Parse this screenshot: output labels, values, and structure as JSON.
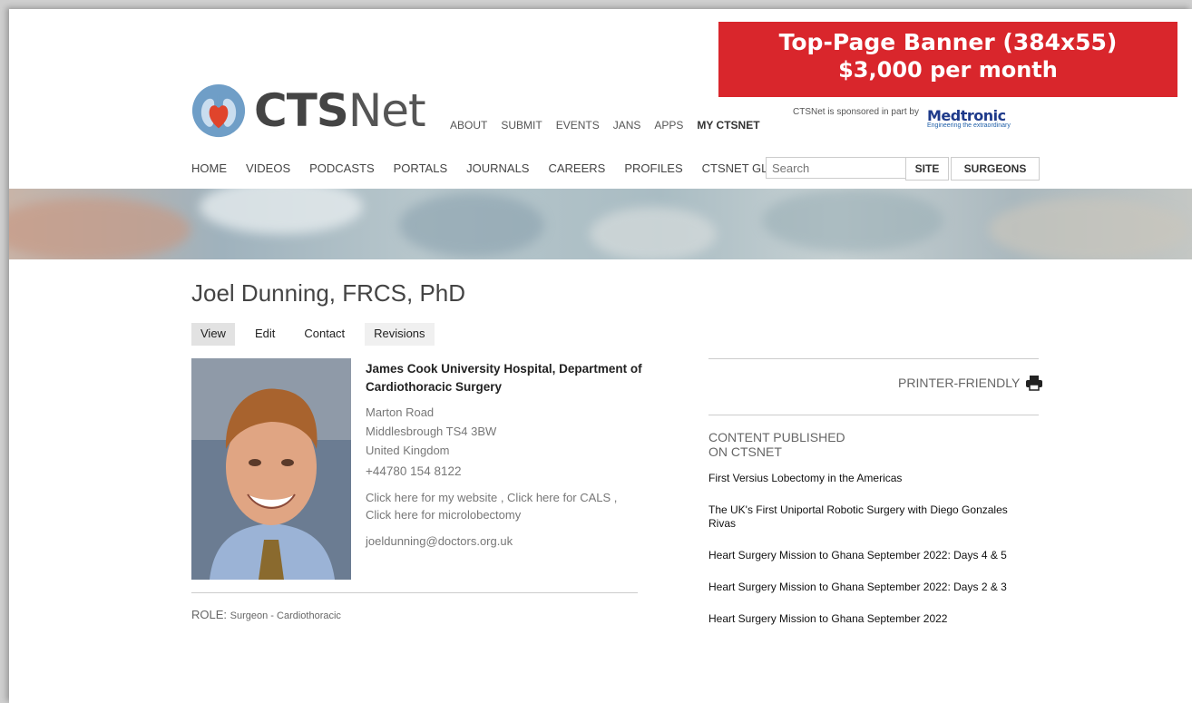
{
  "ad_banner": {
    "line1": "Top-Page Banner (384x55)",
    "line2": "$3,000 per month",
    "color": "#d9262c"
  },
  "logo": {
    "bold": "CTS",
    "light": "Net",
    "icon": "heart-lungs-logo"
  },
  "top_nav": [
    "ABOUT",
    "SUBMIT",
    "EVENTS",
    "JANS",
    "APPS",
    "MY CTSNET"
  ],
  "sponsor": {
    "text": "CTSNet is sponsored in part by",
    "brand": "Medtronic",
    "tagline": "Engineering the extraordinary"
  },
  "main_nav": [
    "HOME",
    "VIDEOS",
    "PODCASTS",
    "PORTALS",
    "JOURNALS",
    "CAREERS",
    "PROFILES",
    "CTSNET GLOBAL"
  ],
  "search": {
    "placeholder": "Search",
    "site_label": "SITE",
    "surgeons_label": "SURGEONS"
  },
  "profile": {
    "name": "Joel Dunning, FRCS, PhD",
    "tabs": [
      "View",
      "Edit",
      "Contact",
      "Revisions"
    ],
    "institution": "James Cook University Hospital, Department of Cardiothoracic Surgery",
    "address_line1": "Marton Road",
    "address_line2": "Middlesbrough  TS4 3BW",
    "address_line3": "United Kingdom",
    "phone": "+44780 154 8122",
    "links": "Click here for my website , Click here for CALS , Click here for microlobectomy",
    "email": "joeldunning@doctors.org.uk",
    "role_label": "ROLE:",
    "role_value": "Surgeon - Cardiothoracic"
  },
  "sidebar": {
    "printer_label": "PRINTER-FRIENDLY",
    "content_title_line1": "CONTENT PUBLISHED",
    "content_title_line2": "ON CTSNET",
    "articles": [
      "First Versius Lobectomy in the Americas",
      "The UK's First Uniportal Robotic Surgery with Diego Gonzales Rivas",
      "Heart Surgery Mission to Ghana September 2022: Days 4 & 5",
      "Heart Surgery Mission to Ghana September 2022: Days 2 & 3",
      "Heart Surgery Mission to Ghana September 2022"
    ]
  }
}
